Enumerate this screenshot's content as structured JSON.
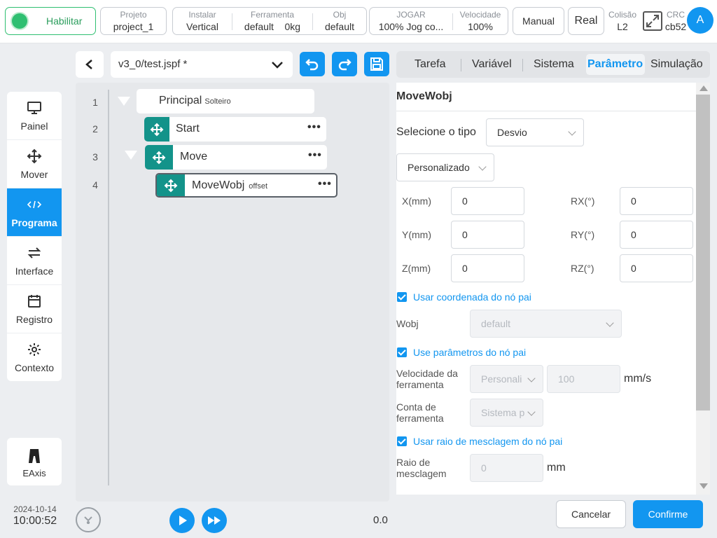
{
  "topbar": {
    "enable_label": "Habilitar",
    "project": {
      "label": "Projeto",
      "value": "project_1"
    },
    "install": {
      "label": "Instalar",
      "value": "Vertical"
    },
    "tool": {
      "label": "Ferramenta",
      "value": "default",
      "load": "0kg"
    },
    "obj": {
      "label": "Obj",
      "value": "default"
    },
    "jog": {
      "label": "JOGAR",
      "value": "100%  Jog co..."
    },
    "speed": {
      "label": "Velocidade",
      "value": "100%"
    },
    "manual_label": "Manual",
    "real_label": "Real",
    "collision": {
      "label": "Colisão",
      "value": "L2"
    },
    "crc": {
      "label": "CRC",
      "value": "cb52"
    },
    "avatar": "A",
    "colors": {
      "accent": "#1296f0",
      "enable_green": "#2fbf71",
      "handle": "#13938a"
    }
  },
  "nav": {
    "items": [
      {
        "label": "Painel",
        "icon": "monitor-icon"
      },
      {
        "label": "Mover",
        "icon": "move-icon"
      },
      {
        "label": "Programa",
        "icon": "code-icon"
      },
      {
        "label": "Interface",
        "icon": "swap-icon"
      },
      {
        "label": "Registro",
        "icon": "calendar-icon"
      },
      {
        "label": "Contexto",
        "icon": "gear-icon"
      }
    ],
    "eaxis_label": "EAxis",
    "date": "2024-10-14",
    "time": "10:00:52"
  },
  "editor": {
    "file": "v3_0/test.jspf *",
    "lines": [
      "1",
      "2",
      "3",
      "4"
    ],
    "nodes": {
      "principal": {
        "name": "Principal",
        "tag": "Solteiro"
      },
      "start": {
        "name": "Start"
      },
      "move": {
        "name": "Move"
      },
      "movewobj": {
        "name": "MoveWobj",
        "tag": "offset"
      }
    },
    "more": "•••",
    "progress_value": "0.0"
  },
  "tabs": [
    "Tarefa",
    "Variável",
    "Sistema",
    "Parâmetro",
    "Simulação"
  ],
  "params": {
    "title": "MoveWobj",
    "type_label": "Selecione o tipo",
    "type_value": "Desvio",
    "mode_value": "Personalizado",
    "x_label": "X(mm)",
    "x_value": "0",
    "y_label": "Y(mm)",
    "y_value": "0",
    "z_label": "Z(mm)",
    "z_value": "0",
    "rx_label": "RX(°)",
    "rx_value": "0",
    "ry_label": "RY(°)",
    "ry_value": "0",
    "rz_label": "RZ(°)",
    "rz_value": "0",
    "use_parent_coord": "Usar coordenada do nó pai",
    "wobj_label": "Wobj",
    "wobj_value": "default",
    "use_parent_params": "Use parâmetros do nó pai",
    "tool_speed_label_1": "Velocidade da",
    "tool_speed_label_2": "ferramenta",
    "tool_speed_mode": "Personali",
    "tool_speed_value": "100",
    "tool_speed_unit": "mm/s",
    "tool_count_label_1": "Conta de",
    "tool_count_label_2": "ferramenta",
    "tool_count_value": "Sistema p",
    "use_parent_blend": "Usar raio de mesclagem do nó pai",
    "blend_label_1": "Raio de",
    "blend_label_2": "mesclagem",
    "blend_value": "0",
    "blend_unit": "mm",
    "cancel_label": "Cancelar",
    "confirm_label": "Confirme"
  }
}
